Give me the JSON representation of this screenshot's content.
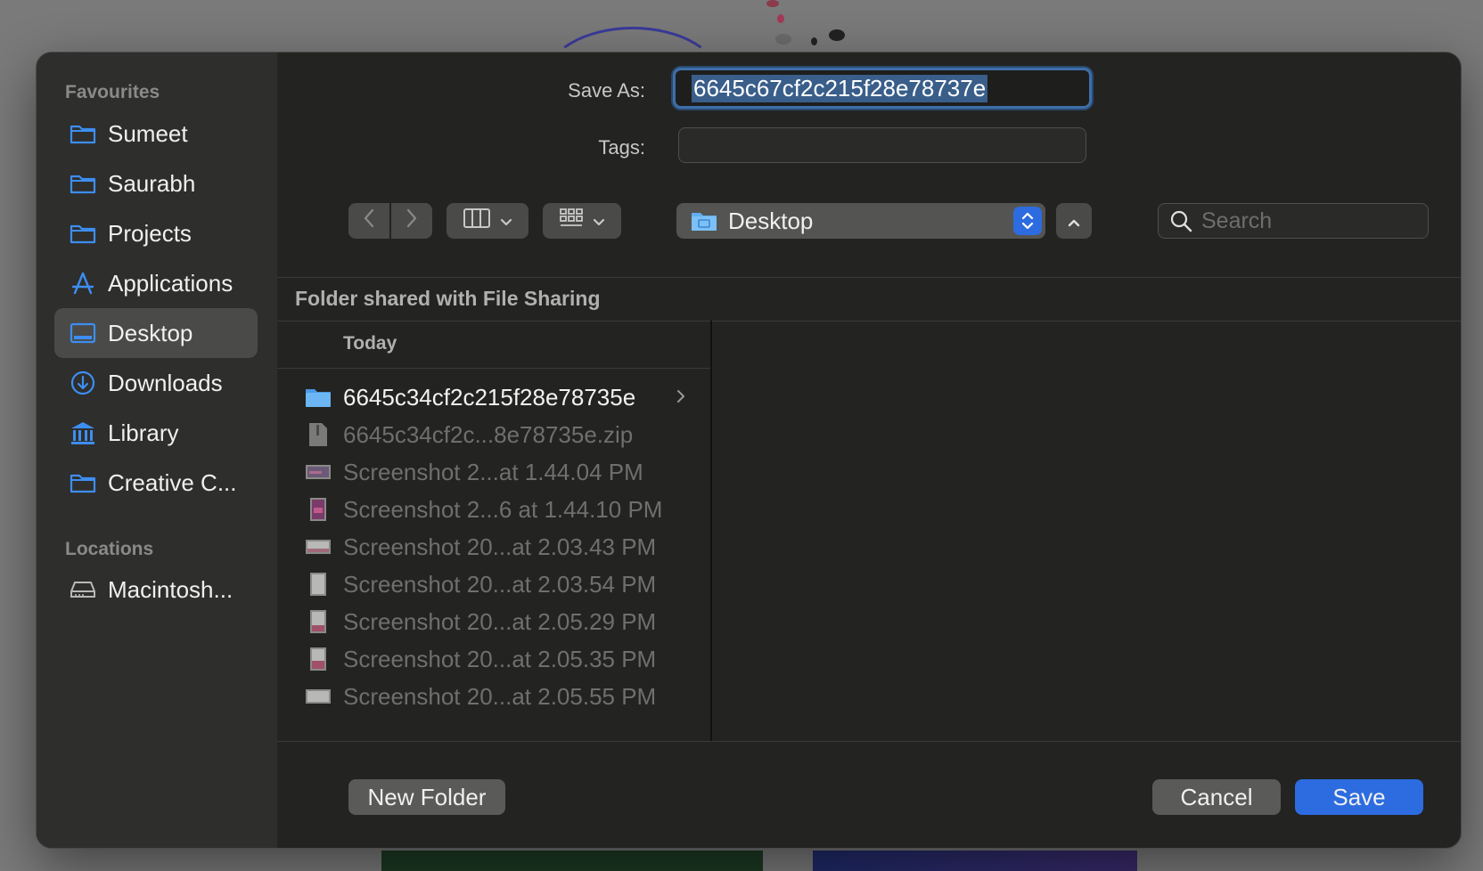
{
  "dialog": {
    "save_as_label": "Save As:",
    "save_as_value": "6645c67cf2c215f28e78737e",
    "tags_label": "Tags:",
    "tags_value": ""
  },
  "sidebar": {
    "favourites_heading": "Favourites",
    "locations_heading": "Locations",
    "items": [
      {
        "label": "Sumeet",
        "icon": "folder-icon"
      },
      {
        "label": "Saurabh",
        "icon": "folder-icon"
      },
      {
        "label": "Projects",
        "icon": "folder-icon"
      },
      {
        "label": "Applications",
        "icon": "applications-icon"
      },
      {
        "label": "Desktop",
        "icon": "desktop-icon",
        "selected": true
      },
      {
        "label": "Downloads",
        "icon": "download-icon"
      },
      {
        "label": "Library",
        "icon": "library-icon"
      },
      {
        "label": "Creative C...",
        "icon": "folder-icon"
      }
    ],
    "locations": [
      {
        "label": "Macintosh...",
        "icon": "hard-drive-icon"
      }
    ]
  },
  "toolbar": {
    "location": "Desktop",
    "search_placeholder": "Search"
  },
  "browser": {
    "shared_banner": "Folder shared with File Sharing",
    "group_header": "Today",
    "files": [
      {
        "name": "6645c34cf2c215f28e78735e",
        "type": "folder",
        "enabled": true
      },
      {
        "name": "6645c34cf2c...8e78735e.zip",
        "type": "zip",
        "enabled": false
      },
      {
        "name": "Screenshot 2...at 1.44.04 PM",
        "type": "image-wide",
        "enabled": false
      },
      {
        "name": "Screenshot 2...6 at 1.44.10 PM",
        "type": "image-tall",
        "enabled": false
      },
      {
        "name": "Screenshot 20...at 2.03.43 PM",
        "type": "image-wide",
        "enabled": false
      },
      {
        "name": "Screenshot 20...at 2.03.54 PM",
        "type": "image-tall",
        "enabled": false
      },
      {
        "name": "Screenshot 20...at 2.05.29 PM",
        "type": "image-tall",
        "enabled": false
      },
      {
        "name": "Screenshot 20...at 2.05.35 PM",
        "type": "image-tall",
        "enabled": false
      },
      {
        "name": "Screenshot 20...at 2.05.55 PM",
        "type": "image-wide",
        "enabled": false
      }
    ]
  },
  "footer": {
    "new_folder_label": "New Folder",
    "cancel_label": "Cancel",
    "save_label": "Save"
  },
  "colors": {
    "accent": "#2d6ce0",
    "sidebar_icon": "#3d8ef0",
    "dialog_bg": "#232321",
    "sidebar_bg": "#2e2e2d"
  }
}
